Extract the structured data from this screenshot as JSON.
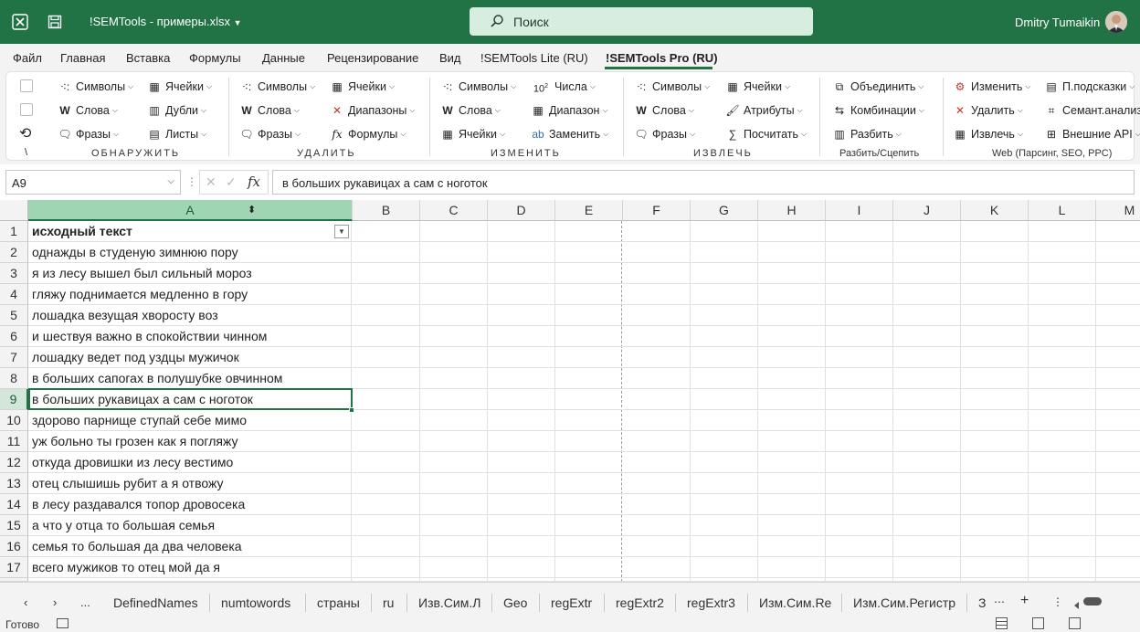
{
  "title_bar": {
    "filename": "!SEMTools - примеры.xlsx",
    "search_placeholder": "Поиск",
    "user": "Dmitry Tumaikin",
    "accent_color": "#217346"
  },
  "menu": [
    "Файл",
    "Главная",
    "Вставка",
    "Формулы",
    "Данные",
    "Рецензирование",
    "Вид",
    "!SEMTools Lite (RU)",
    "!SEMTools Pro (RU)"
  ],
  "ribbon": {
    "groups": [
      {
        "name": "ОБНАРУЖИТЬ",
        "buttons": [
          "Символы",
          "Ячейки",
          "Слова",
          "Дубли",
          "Фразы",
          "Листы"
        ]
      },
      {
        "name": "УДАЛИТЬ",
        "buttons": [
          "Символы",
          "Ячейки",
          "Слова",
          "Диапазоны",
          "Фразы",
          "Формулы"
        ]
      },
      {
        "name": "ИЗМЕНИТЬ",
        "buttons": [
          "Символы",
          "Числа",
          "Слова",
          "Диапазон",
          "Ячейки",
          "Заменить"
        ]
      },
      {
        "name": "ИЗВЛЕЧЬ",
        "buttons": [
          "Символы",
          "Ячейки",
          "Слова",
          "Атрибуты",
          "Фразы",
          "Посчитать"
        ]
      },
      {
        "name": "Разбить/Сцепить",
        "buttons": [
          "Объединить",
          "Комбинации",
          "Разбить"
        ]
      },
      {
        "name": "Web (Парсинг, SEO, PPC)",
        "buttons": [
          "Изменить",
          "П.подсказки",
          "Удалить",
          "Семант.анализ",
          "Извлечь",
          "Внешние API"
        ]
      }
    ],
    "misc": {
      "backslash": "\\",
      "num_sup": "10",
      "num_exp": "2"
    }
  },
  "formula_bar": {
    "name_box": "A9",
    "fx": "fx",
    "content": "в больших рукавицах а сам с ноготок"
  },
  "sheet": {
    "columns": [
      "A",
      "B",
      "C",
      "D",
      "E",
      "F",
      "G",
      "H",
      "I",
      "J",
      "K",
      "L",
      "M"
    ],
    "row_numbers": [
      "1",
      "2",
      "3",
      "4",
      "5",
      "6",
      "7",
      "8",
      "9",
      "10",
      "11",
      "12",
      "13",
      "14",
      "15",
      "16",
      "17"
    ],
    "column_a": [
      "исходный текст",
      "однажды в студеную зимнюю пору",
      "я из лесу вышел был сильный мороз",
      "гляжу поднимается медленно в гору",
      "лошадка везущая хворосту воз",
      "и шествуя важно в спокойствии чинном",
      "лошадку ведет под уздцы мужичок",
      "в больших сапогах в полушубке овчинном",
      "в больших рукавицах а сам с ноготок",
      "здорово парнище ступай себе мимо",
      "уж больно ты грозен как я погляжу",
      "откуда дровишки из лесу вестимо",
      "отец слышишь рубит а я отвожу",
      "в лесу раздавался топор дровосека",
      "а что у отца то большая семья",
      "семья то большая да два человека",
      "всего мужиков то отец мой да я"
    ],
    "active_cell": "A9",
    "partial_row": "18"
  },
  "sheet_tabs": [
    "DefinedNames",
    "numtowords",
    "страны",
    "ru",
    "Изв.Сим.Л",
    "Geo",
    "regExtr",
    "regExtr2",
    "regExtr3",
    "Изм.Сим.Re",
    "Изм.Сим.Регистр"
  ],
  "sheet_tabs_more": "...",
  "sheet_tabs_partial": "З",
  "status": {
    "ready": "Готово"
  }
}
